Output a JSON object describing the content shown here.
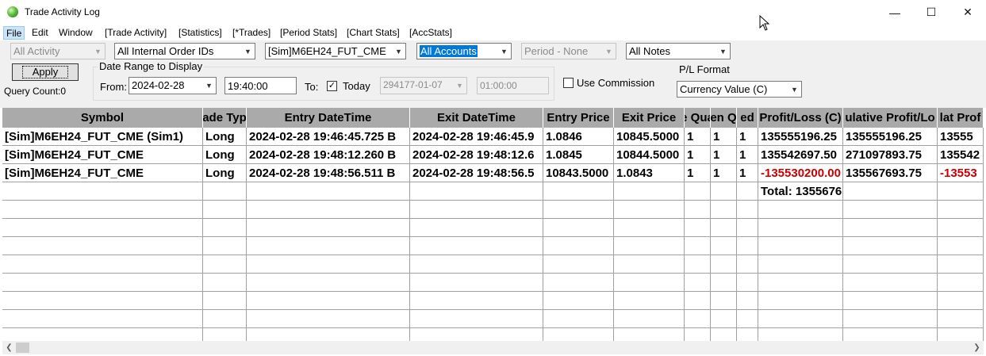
{
  "window": {
    "title": "Trade Activity Log",
    "minimize": "—",
    "maximize": "☐",
    "close": "✕"
  },
  "menu": [
    "File",
    "Edit",
    "Window",
    "[Trade Activity]",
    "[Statistics]",
    "[*Trades]",
    "[Period Stats]",
    "[Chart Stats]",
    "[AccStats]"
  ],
  "filters": {
    "activity": "All Activity",
    "order_ids": "All Internal Order IDs",
    "symbol": "[Sim]M6EH24_FUT_CME",
    "accounts": "All Accounts",
    "period": "Period - None",
    "notes": "All Notes"
  },
  "apply_label": "Apply",
  "query_count": "Query Count:0",
  "date_range": {
    "legend": "Date Range to Display",
    "from_label": "From:",
    "from_date": "2024-02-28",
    "from_time": "19:40:00",
    "to_label": "To:",
    "today_label": "Today",
    "today_checked": "✓",
    "to_date": "294177-01-07",
    "to_time": "01:00:00"
  },
  "use_commission_label": "Use Commission",
  "pl_format": {
    "label": "P/L Format",
    "value": "Currency Value (C)"
  },
  "table": {
    "headers": [
      "Symbol",
      "ade Typ",
      "Entry DateTime",
      "Exit DateTime",
      "Entry Price",
      "Exit Price",
      "e Qua",
      "en Q",
      "ed",
      "Profit/Loss (C)",
      "ulative Profit/Lo",
      "lat Prof"
    ],
    "rows": [
      [
        "[Sim]M6EH24_FUT_CME (Sim1)",
        "Long",
        "2024-02-28  19:46:45.725 B",
        "2024-02-28  19:46:45.9",
        "1.0846",
        "10845.5000",
        "1",
        "1",
        "1",
        "135555196.25",
        "135555196.25",
        "13555"
      ],
      [
        "[Sim]M6EH24_FUT_CME",
        "Long",
        "2024-02-28  19:48:12.260 B",
        "2024-02-28  19:48:12.6",
        "1.0845",
        "10844.5000",
        "1",
        "1",
        "1",
        "135542697.50",
        "271097893.75",
        "135542"
      ],
      [
        "[Sim]M6EH24_FUT_CME",
        "Long",
        "2024-02-28  19:48:56.511 B",
        "2024-02-28  19:48:56.5",
        "10843.5000",
        "1.0843",
        "1",
        "1",
        "1",
        "-135530200.00",
        "135567693.75",
        "-13553"
      ]
    ],
    "negative_cells": [
      [
        2,
        9
      ],
      [
        2,
        11
      ]
    ],
    "total": "Total: 1355676"
  },
  "colors": {
    "header_bg": "#aaaaaa",
    "negative": "#cc0000",
    "selection": "#0078d7"
  }
}
